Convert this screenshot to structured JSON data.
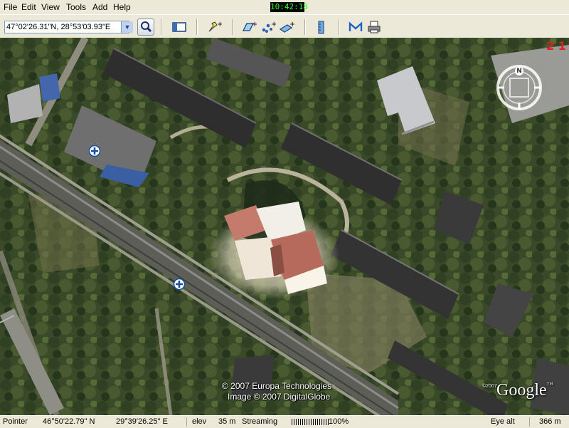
{
  "menu": {
    "items": [
      "File",
      "Edit",
      "View",
      "Tools",
      "Add",
      "Help"
    ]
  },
  "clock": "10:42:18",
  "toolbar": {
    "coordinates_value": "47°02'26.31\"N, 28°53'03.93\"E",
    "icons": [
      "search-icon",
      "sidebar-toggle-icon",
      "placemark-icon",
      "polygon-icon",
      "path-icon",
      "image-overlay-icon",
      "ruler-icon",
      "email-icon",
      "print-icon"
    ]
  },
  "map": {
    "copyright_line1": "© 2007 Europa Technologies",
    "copyright_line2": "Image © 2007 DigitalGlobe",
    "small_copyright": "©2007",
    "brand": "Google",
    "brand_tm": "™",
    "compass_north": "N",
    "corner_text": "2 1"
  },
  "status": {
    "pointer_label": "Pointer",
    "latitude": "46°50'22.79\" N",
    "longitude": "29°39'26.25\" E",
    "elev_label": "elev",
    "elev_value": "35 m",
    "streaming_label": "Streaming",
    "streaming_percent": "100%",
    "eye_alt_label": "Eye alt",
    "eye_alt_value": "366 m"
  }
}
